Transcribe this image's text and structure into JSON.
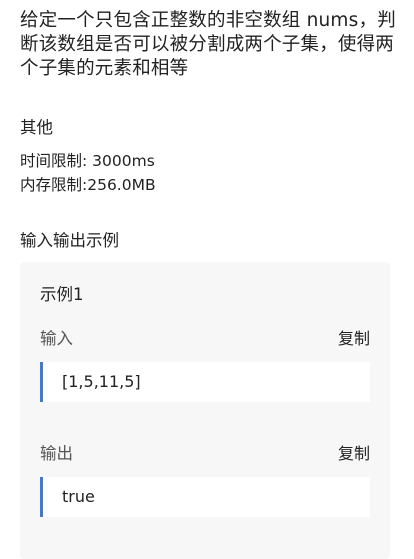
{
  "problem": {
    "description": "给定一个只包含正整数的非空数组 nums，判断该数组是否可以被分割成两个子集，使得两个子集的元素和相等"
  },
  "other": {
    "title": "其他",
    "time_limit": "时间限制: 3000ms",
    "memory_limit": "内存限制:256.0MB"
  },
  "examples": {
    "title": "输入输出示例",
    "items": [
      {
        "name": "示例1",
        "input_label": "输入",
        "input_copy": "复制",
        "input_value": "[1,5,11,5]",
        "output_label": "输出",
        "output_copy": "复制",
        "output_value": "true"
      }
    ]
  },
  "colors": {
    "accent": "#3d7bd9",
    "card_bg": "#f7f7f7"
  }
}
